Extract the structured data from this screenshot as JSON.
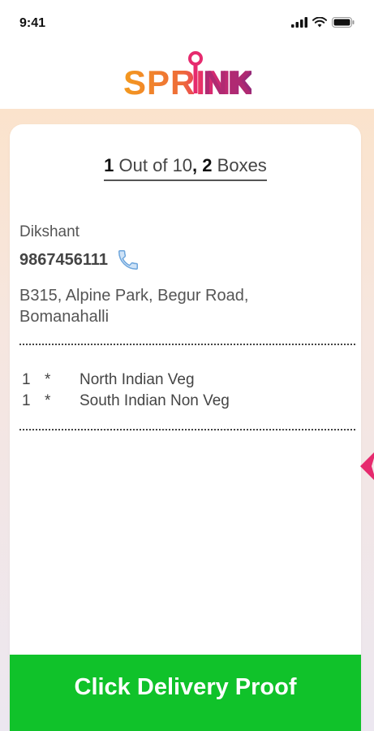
{
  "status_bar": {
    "time": "9:41"
  },
  "header": {
    "brand": "SPRINK"
  },
  "progress": {
    "current": "1",
    "out_of_text": " Out of 10",
    "boxes_count": "2",
    "boxes_text": " Boxes"
  },
  "customer": {
    "name": "Dikshant",
    "phone": "9867456111",
    "address_line1": "B315, Alpine Park, Begur Road,",
    "address_line2": "Bomanahalli"
  },
  "items": [
    {
      "qty": "1",
      "sep": "*",
      "name": "North Indian Veg"
    },
    {
      "qty": "1",
      "sep": "*",
      "name": "South Indian Non Veg"
    }
  ],
  "actions": {
    "delivery_proof_label": "Click Delivery Proof"
  },
  "colors": {
    "button_green": "#10c22a",
    "logo_orange": "#f39a1f",
    "logo_pink": "#e62a6e",
    "logo_purple": "#8a2a7a"
  }
}
